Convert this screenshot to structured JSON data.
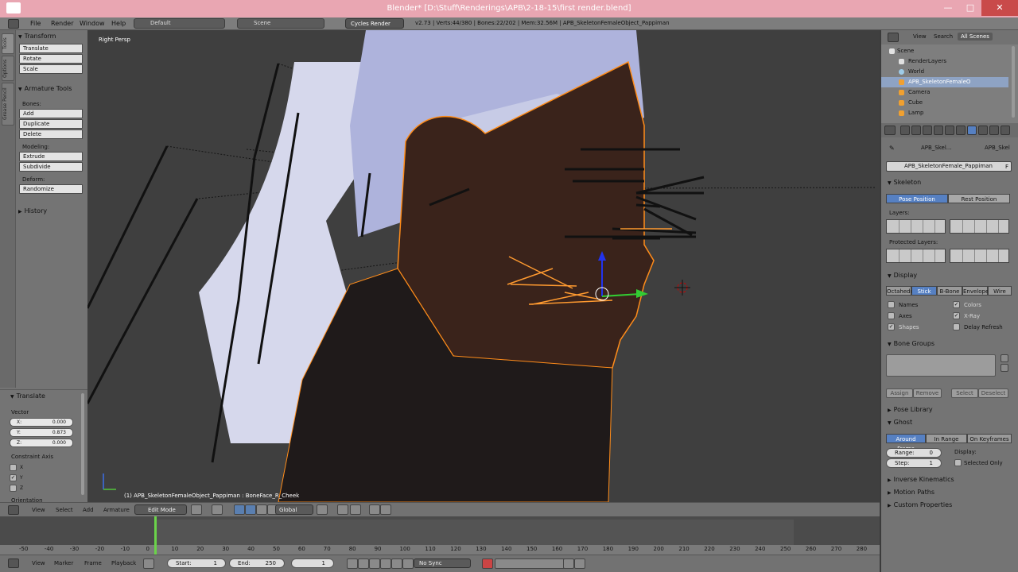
{
  "window": {
    "title": "Blender* [D:\\Stuff\\Renderings\\APB\\2-18-15\\first render.blend]"
  },
  "info": {
    "menus": [
      "File",
      "Render",
      "Window",
      "Help"
    ],
    "screen_layout": "Default",
    "scene": "Scene",
    "renderer": "Cycles Render",
    "stats": "v2.73 | Verts:44/380 | Bones:22/202 | Mem:32.56M | APB_SkeletonFemaleObject_Pappiman"
  },
  "toolshelf": {
    "tabs": [
      "Tools",
      "Options",
      "Grease Pencil"
    ],
    "transform": {
      "header": "Transform",
      "buttons": [
        "Translate",
        "Rotate",
        "Scale"
      ]
    },
    "armature": {
      "header": "Armature Tools",
      "bones_label": "Bones:",
      "bones": [
        "Add",
        "Duplicate",
        "Delete"
      ],
      "modeling_label": "Modeling:",
      "modeling": [
        "Extrude",
        "Subdivide"
      ],
      "deform_label": "Deform:",
      "deform": [
        "Randomize"
      ]
    },
    "history": "History"
  },
  "operator": {
    "header": "Translate",
    "vector_label": "Vector",
    "x": {
      "k": "X:",
      "v": "0.000"
    },
    "y": {
      "k": "Y:",
      "v": "0.873"
    },
    "z": {
      "k": "Z:",
      "v": "0.000"
    },
    "constraint_label": "Constraint Axis",
    "axes": [
      "X",
      "Y",
      "Z"
    ],
    "orientation_label": "Orientation"
  },
  "viewport": {
    "view_label": "Right Persp",
    "object_label": "(1) APB_SkeletonFemaleObject_Pappiman : BoneFace_R_Cheek"
  },
  "view_header": {
    "menus": [
      "View",
      "Select",
      "Add",
      "Armature"
    ],
    "mode": "Edit Mode",
    "orientation": "Global"
  },
  "timeline": {
    "ticks": [
      "-50",
      "-40",
      "-30",
      "-20",
      "-10",
      "0",
      "10",
      "20",
      "30",
      "40",
      "50",
      "60",
      "70",
      "80",
      "90",
      "100",
      "110",
      "120",
      "130",
      "140",
      "150",
      "160",
      "170",
      "180",
      "190",
      "200",
      "210",
      "220",
      "230",
      "240",
      "250",
      "260",
      "270",
      "280"
    ],
    "menus": [
      "View",
      "Marker",
      "Frame",
      "Playback"
    ],
    "start": {
      "k": "Start:",
      "v": "1"
    },
    "end": {
      "k": "End:",
      "v": "250"
    },
    "current": "1",
    "sync": "No Sync"
  },
  "outliner": {
    "tabs": [
      "View",
      "Search",
      "All Scenes"
    ],
    "rows": [
      "Scene",
      "RenderLayers",
      "World",
      "APB_SkeletonFemaleO",
      "Camera",
      "Cube",
      "Lamp"
    ]
  },
  "properties": {
    "breadcrumb": [
      "APB_Skel...",
      "APB_Skel"
    ],
    "name_field": "APB_SkeletonFemale_Pappiman",
    "name_f": "F",
    "skeleton": {
      "header": "Skeleton",
      "pose_position": "Pose Position",
      "rest_position": "Rest Position",
      "layers_label": "Layers:",
      "protected_label": "Protected Layers:"
    },
    "display": {
      "header": "Display",
      "types": [
        "Octahedral",
        "Stick",
        "B-Bone",
        "Envelope",
        "Wire"
      ],
      "names": "Names",
      "axes": "Axes",
      "shapes": "Shapes",
      "colors": "Colors",
      "xray": "X-Ray",
      "delay_refresh": "Delay Refresh"
    },
    "bone_groups": {
      "header": "Bone Groups",
      "assign": "Assign",
      "remove": "Remove",
      "select": "Select",
      "deselect": "Deselect"
    },
    "pose_library": "Pose Library",
    "ghost": {
      "header": "Ghost",
      "modes": [
        "Around Frame",
        "In Range",
        "On Keyframes"
      ],
      "range": {
        "k": "Range:",
        "v": "0"
      },
      "step": {
        "k": "Step:",
        "v": "1"
      },
      "display_label": "Display:",
      "selected_only": "Selected Only"
    },
    "inverse_kinematics": "Inverse Kinematics",
    "motion_paths": "Motion Paths",
    "custom_properties": "Custom Properties"
  },
  "colors": {
    "title_bar": "#e9a6b2",
    "accent_blue": "#5680c2",
    "selection_orange": "#ff8c1a",
    "frame_green": "#6bd34a"
  }
}
